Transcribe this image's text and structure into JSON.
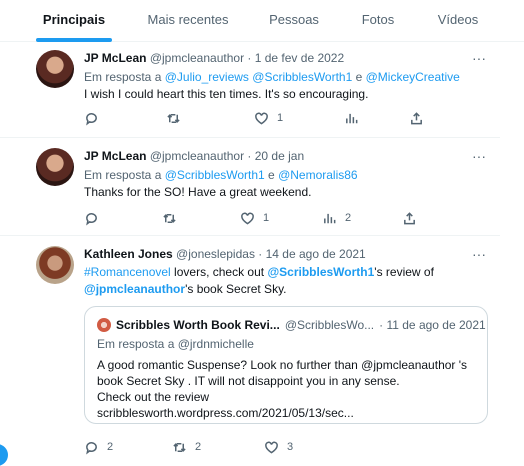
{
  "tabs": [
    {
      "label": "Principais",
      "active": true
    },
    {
      "label": "Mais recentes",
      "active": false
    },
    {
      "label": "Pessoas",
      "active": false
    },
    {
      "label": "Fotos",
      "active": false
    },
    {
      "label": "Vídeos",
      "active": false
    }
  ],
  "accent_color": "#1d9bf0",
  "tweets": [
    {
      "name": "JP McLean",
      "handle": "@jpmcleanauthor",
      "date": "· 1 de fev de 2022",
      "more": "···",
      "reply_prefix": "Em resposta a",
      "reply_to": [
        "@Julio_reviews",
        "@ScribblesWorth1",
        "@MickeyCreative"
      ],
      "reply_sep": [
        " ",
        " e "
      ],
      "text": "I wish I could heart this ten times. It's so encouraging.",
      "stats": {
        "replies": "",
        "retweets": "",
        "likes": "1",
        "views": ""
      }
    },
    {
      "name": "JP McLean",
      "handle": "@jpmcleanauthor",
      "date": "· 20 de jan",
      "more": "···",
      "reply_prefix": "Em resposta a",
      "reply_to": [
        "@ScribblesWorth1",
        "@Nemoralis86"
      ],
      "reply_sep": [
        " e "
      ],
      "text": "Thanks for the SO! Have a great weekend.",
      "stats": {
        "replies": "",
        "retweets": "",
        "likes": "1",
        "views": "2"
      }
    },
    {
      "name": "Kathleen Jones",
      "handle": "@joneslepidas",
      "date": "· 14 de ago de 2021",
      "more": "···",
      "text_parts": {
        "hashtag": "#Romancenovel",
        "t1": " lovers, check out ",
        "mention1": "@ScribblesWorth1",
        "t2": "'s review of",
        "mention2": "@jpmcleanauthor",
        "t3": "'s book Secret Sky."
      },
      "quote": {
        "name": "Scribbles Worth Book Revi...",
        "handle": "@ScribblesWo...",
        "date": "· 11 de ago de 2021",
        "reply_line": "Em resposta a @jrdnmichelle",
        "body_lines": [
          "A good romantic Suspense? Look no further than @jpmcleanauthor 's",
          "book Secret Sky . IT will not disappoint you in any sense.",
          "Check out the review",
          "scribblesworth.wordpress.com/2021/05/13/sec..."
        ]
      },
      "stats": {
        "replies": "2",
        "retweets": "2",
        "likes": "3",
        "views": ""
      }
    }
  ]
}
